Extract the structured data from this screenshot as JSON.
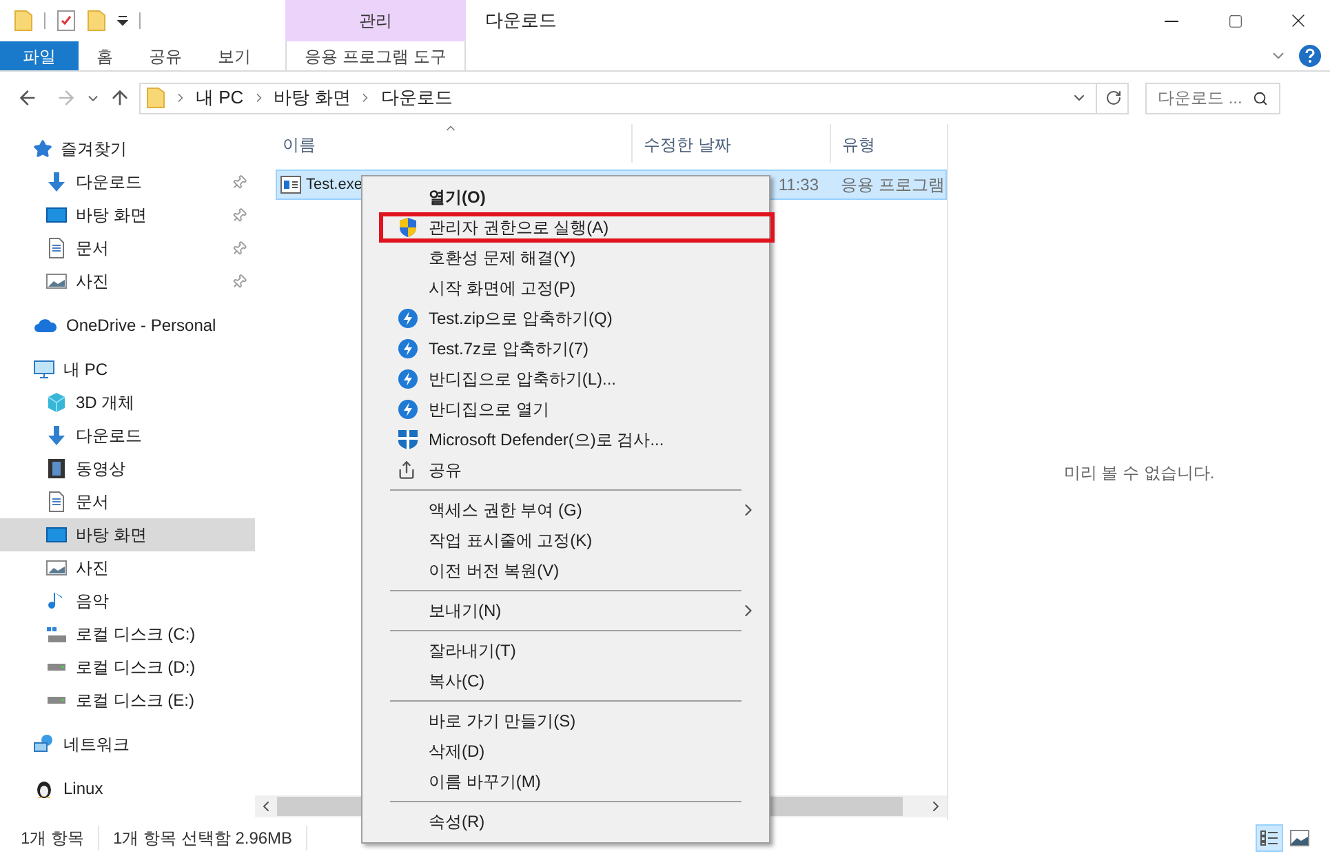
{
  "window": {
    "title": "다운로드",
    "context_group": "관리"
  },
  "ribbon": {
    "tabs": [
      {
        "label": "파일",
        "kind": "file"
      },
      {
        "label": "홈",
        "kind": "tab"
      },
      {
        "label": "공유",
        "kind": "tab"
      },
      {
        "label": "보기",
        "kind": "tab"
      },
      {
        "label": "응용 프로그램 도구",
        "kind": "context"
      }
    ]
  },
  "address_bar": {
    "path": [
      "내 PC",
      "바탕 화면",
      "다운로드"
    ]
  },
  "search": {
    "placeholder": "다운로드 ..."
  },
  "sidebar": {
    "sections": [
      {
        "label": "즐겨찾기",
        "kind": "star",
        "selected": false,
        "children": [
          {
            "label": "다운로드",
            "kind": "download",
            "pinned": true,
            "selected": false
          },
          {
            "label": "바탕 화면",
            "kind": "desktop",
            "pinned": true,
            "selected": false
          },
          {
            "label": "문서",
            "kind": "document",
            "pinned": true,
            "selected": false
          },
          {
            "label": "사진",
            "kind": "pictures",
            "pinned": true,
            "selected": false
          }
        ]
      },
      {
        "label": "OneDrive - Personal",
        "kind": "cloud",
        "selected": false
      },
      {
        "label": "내 PC",
        "kind": "pc",
        "selected": false,
        "children": [
          {
            "label": "3D 개체",
            "kind": "cube",
            "pinned": false,
            "selected": false
          },
          {
            "label": "다운로드",
            "kind": "download",
            "pinned": false,
            "selected": false
          },
          {
            "label": "동영상",
            "kind": "video",
            "pinned": false,
            "selected": false
          },
          {
            "label": "문서",
            "kind": "document",
            "pinned": false,
            "selected": false
          },
          {
            "label": "바탕 화면",
            "kind": "desktop",
            "pinned": false,
            "selected": true
          },
          {
            "label": "사진",
            "kind": "pictures",
            "pinned": false,
            "selected": false
          },
          {
            "label": "음악",
            "kind": "music",
            "pinned": false,
            "selected": false
          },
          {
            "label": "로컬 디스크 (C:)",
            "kind": "system-drive",
            "pinned": false,
            "selected": false
          },
          {
            "label": "로컬 디스크 (D:)",
            "kind": "drive",
            "pinned": false,
            "selected": false
          },
          {
            "label": "로컬 디스크 (E:)",
            "kind": "drive",
            "pinned": false,
            "selected": false
          }
        ]
      },
      {
        "label": "네트워크",
        "kind": "network",
        "selected": false
      },
      {
        "label": "Linux",
        "kind": "linux",
        "selected": false
      }
    ]
  },
  "file_list": {
    "columns": [
      "이름",
      "수정한 날짜",
      "유형"
    ],
    "rows": [
      {
        "name": "Test.exe",
        "modified": "11:33",
        "type": "응용 프로그램",
        "selected": true
      }
    ]
  },
  "preview": {
    "message": "미리 볼 수 없습니다."
  },
  "context_menu": {
    "groups": [
      {
        "items": [
          {
            "label": "열기(O)",
            "kind": "none",
            "bold": true,
            "submenu": false,
            "highlighted": false
          },
          {
            "label": "관리자 권한으로 실행(A)",
            "kind": "shield",
            "bold": false,
            "submenu": false,
            "highlighted": true
          },
          {
            "label": "호환성 문제 해결(Y)",
            "kind": "none",
            "bold": false,
            "submenu": false,
            "highlighted": false
          },
          {
            "label": "시작 화면에 고정(P)",
            "kind": "none",
            "bold": false,
            "submenu": false,
            "highlighted": false
          },
          {
            "label": "Test.zip으로 압축하기(Q)",
            "kind": "bandizip",
            "bold": false,
            "submenu": false,
            "highlighted": false
          },
          {
            "label": "Test.7z로 압축하기(7)",
            "kind": "bandizip",
            "bold": false,
            "submenu": false,
            "highlighted": false
          },
          {
            "label": "반디집으로 압축하기(L)...",
            "kind": "bandizip",
            "bold": false,
            "submenu": false,
            "highlighted": false
          },
          {
            "label": "반디집으로 열기",
            "kind": "bandizip",
            "bold": false,
            "submenu": false,
            "highlighted": false
          },
          {
            "label": "Microsoft Defender(으)로 검사...",
            "kind": "defender",
            "bold": false,
            "submenu": false,
            "highlighted": false
          },
          {
            "label": "공유",
            "kind": "share",
            "bold": false,
            "submenu": false,
            "highlighted": false
          }
        ]
      },
      {
        "items": [
          {
            "label": "액세스 권한 부여 (G)",
            "kind": "none",
            "bold": false,
            "submenu": true,
            "highlighted": false
          },
          {
            "label": "작업 표시줄에 고정(K)",
            "kind": "none",
            "bold": false,
            "submenu": false,
            "highlighted": false
          },
          {
            "label": "이전 버전 복원(V)",
            "kind": "none",
            "bold": false,
            "submenu": false,
            "highlighted": false
          }
        ]
      },
      {
        "items": [
          {
            "label": "보내기(N)",
            "kind": "none",
            "bold": false,
            "submenu": true,
            "highlighted": false
          }
        ]
      },
      {
        "items": [
          {
            "label": "잘라내기(T)",
            "kind": "none",
            "bold": false,
            "submenu": false,
            "highlighted": false
          },
          {
            "label": "복사(C)",
            "kind": "none",
            "bold": false,
            "submenu": false,
            "highlighted": false
          }
        ]
      },
      {
        "items": [
          {
            "label": "바로 가기 만들기(S)",
            "kind": "none",
            "bold": false,
            "submenu": false,
            "highlighted": false
          },
          {
            "label": "삭제(D)",
            "kind": "none",
            "bold": false,
            "submenu": false,
            "highlighted": false
          },
          {
            "label": "이름 바꾸기(M)",
            "kind": "none",
            "bold": false,
            "submenu": false,
            "highlighted": false
          }
        ]
      },
      {
        "items": [
          {
            "label": "속성(R)",
            "kind": "none",
            "bold": false,
            "submenu": false,
            "highlighted": false
          }
        ]
      }
    ]
  },
  "status_bar": {
    "item_count": "1개 항목",
    "selection": "1개 항목 선택함 2.96MB",
    "views": [
      {
        "kind": "details",
        "selected": true
      },
      {
        "kind": "thumbnails",
        "selected": false
      }
    ]
  }
}
